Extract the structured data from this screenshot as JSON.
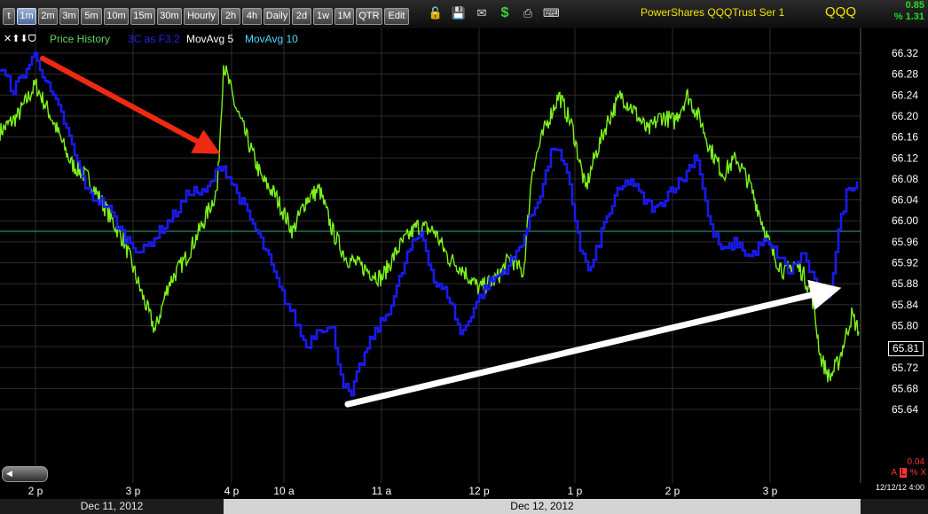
{
  "toolbar": {
    "timeframes": [
      "t",
      "1m",
      "2m",
      "3m",
      "5m",
      "10m",
      "15m",
      "30m",
      "Hourly",
      "2h",
      "4h",
      "Daily",
      "2d",
      "1w",
      "1M",
      "QTR",
      "Edit"
    ],
    "active_timeframe": "1m",
    "icons": [
      "unlock-icon",
      "save-icon",
      "mail-icon",
      "dollar-icon",
      "print-icon",
      "keyboard-icon"
    ],
    "symbol_description": "PowerShares QQQTrust Ser 1",
    "symbol": "QQQ",
    "change": "0.85",
    "change_percent": "% 1.31"
  },
  "legend": {
    "nav_icons": "✕⬆⬇ᗜ",
    "items": [
      {
        "label": "Price History",
        "color": "#5cd65c"
      },
      {
        "label": "3C as F3.2",
        "color": "#2424e0"
      },
      {
        "label": "MovAvg 5",
        "color": "#ffffff"
      },
      {
        "label": "MovAvg 10",
        "color": "#4fd9ff"
      }
    ]
  },
  "footer": {
    "date_left": "Dec 11, 2012",
    "date_right": "Dec 12, 2012",
    "date_stamp": "12/12/12 4:00",
    "volume_label": "0.04",
    "alerts": [
      "A",
      "L",
      "%",
      "X"
    ]
  },
  "colors": {
    "price": "#7cf21c",
    "indicator": "#1a1aee",
    "arrow_down": "#ee2a12",
    "arrow_up": "#ffffff",
    "grid": "#2c2c2c",
    "ref_line": "#2fa98c"
  },
  "chart_data": {
    "type": "line",
    "y_axis": {
      "ticks": [
        66.32,
        66.28,
        66.24,
        66.2,
        66.16,
        66.12,
        66.08,
        66.04,
        66.0,
        65.96,
        65.92,
        65.88,
        65.84,
        65.8,
        65.76,
        65.72,
        65.68,
        65.64
      ],
      "tick_labels": [
        "66.32",
        "66.28",
        "66.24",
        "66.20",
        "66.16",
        "66.12",
        "66.08",
        "66.04",
        "66.00",
        "65.96",
        "65.92",
        "65.88",
        "65.84",
        "65.80",
        "65.76",
        "65.72",
        "65.68",
        "65.64"
      ],
      "range": [
        65.63,
        66.34
      ],
      "current_price": "65.81"
    },
    "x_axis": {
      "tick_labels": [
        "2 p",
        "3 p",
        "4 p",
        "10 a",
        "11 a",
        "12 p",
        "1 p",
        "2 p",
        "3 p"
      ]
    },
    "reference_line": 65.98,
    "series": [
      {
        "name": "Price History",
        "keypoints": [
          [
            0,
            66.17
          ],
          [
            20,
            66.2
          ],
          [
            40,
            66.26
          ],
          [
            60,
            66.19
          ],
          [
            80,
            66.11
          ],
          [
            100,
            66.08
          ],
          [
            120,
            66.02
          ],
          [
            140,
            65.96
          ],
          [
            160,
            65.86
          ],
          [
            175,
            65.79
          ],
          [
            190,
            65.88
          ],
          [
            210,
            65.93
          ],
          [
            230,
            66.0
          ],
          [
            245,
            66.06
          ],
          [
            252,
            66.3
          ],
          [
            265,
            66.22
          ],
          [
            280,
            66.15
          ],
          [
            295,
            66.08
          ],
          [
            310,
            66.05
          ],
          [
            330,
            65.98
          ],
          [
            345,
            66.04
          ],
          [
            360,
            66.06
          ],
          [
            375,
            65.98
          ],
          [
            390,
            65.93
          ],
          [
            410,
            65.91
          ],
          [
            430,
            65.89
          ],
          [
            450,
            65.95
          ],
          [
            470,
            65.99
          ],
          [
            490,
            65.98
          ],
          [
            505,
            65.93
          ],
          [
            520,
            65.91
          ],
          [
            540,
            65.87
          ],
          [
            560,
            65.89
          ],
          [
            575,
            65.93
          ],
          [
            590,
            65.9
          ],
          [
            600,
            66.1
          ],
          [
            615,
            66.18
          ],
          [
            630,
            66.24
          ],
          [
            645,
            66.18
          ],
          [
            660,
            66.06
          ],
          [
            670,
            66.12
          ],
          [
            685,
            66.19
          ],
          [
            700,
            66.24
          ],
          [
            715,
            66.21
          ],
          [
            730,
            66.17
          ],
          [
            745,
            66.2
          ],
          [
            760,
            66.19
          ],
          [
            775,
            66.24
          ],
          [
            790,
            66.19
          ],
          [
            800,
            66.14
          ],
          [
            815,
            66.09
          ],
          [
            830,
            66.12
          ],
          [
            845,
            66.07
          ],
          [
            855,
            66.02
          ],
          [
            870,
            65.94
          ],
          [
            885,
            65.9
          ],
          [
            895,
            65.92
          ],
          [
            905,
            65.9
          ],
          [
            915,
            65.86
          ],
          [
            925,
            65.74
          ],
          [
            935,
            65.7
          ],
          [
            945,
            65.73
          ],
          [
            960,
            65.82
          ],
          [
            968,
            65.79
          ]
        ]
      },
      {
        "name": "3C as F3.2",
        "keypoints": [
          [
            0,
            66.29
          ],
          [
            15,
            66.25
          ],
          [
            30,
            66.29
          ],
          [
            40,
            66.32
          ],
          [
            55,
            66.25
          ],
          [
            70,
            66.2
          ],
          [
            85,
            66.12
          ],
          [
            100,
            66.05
          ],
          [
            120,
            66.03
          ],
          [
            140,
            65.97
          ],
          [
            160,
            65.94
          ],
          [
            180,
            65.98
          ],
          [
            200,
            66.02
          ],
          [
            215,
            66.06
          ],
          [
            230,
            66.05
          ],
          [
            240,
            66.08
          ],
          [
            250,
            66.11
          ],
          [
            265,
            66.06
          ],
          [
            280,
            66.01
          ],
          [
            300,
            65.94
          ],
          [
            315,
            65.87
          ],
          [
            330,
            65.82
          ],
          [
            345,
            65.76
          ],
          [
            360,
            65.8
          ],
          [
            375,
            65.79
          ],
          [
            385,
            65.7
          ],
          [
            395,
            65.66
          ],
          [
            405,
            65.72
          ],
          [
            420,
            65.78
          ],
          [
            435,
            65.82
          ],
          [
            445,
            65.86
          ],
          [
            460,
            65.94
          ],
          [
            475,
            65.98
          ],
          [
            490,
            65.88
          ],
          [
            505,
            65.86
          ],
          [
            520,
            65.78
          ],
          [
            535,
            65.84
          ],
          [
            550,
            65.88
          ],
          [
            565,
            65.9
          ],
          [
            580,
            65.93
          ],
          [
            595,
            65.99
          ],
          [
            610,
            66.06
          ],
          [
            625,
            66.15
          ],
          [
            640,
            66.08
          ],
          [
            655,
            65.94
          ],
          [
            665,
            65.9
          ],
          [
            680,
            65.99
          ],
          [
            695,
            66.05
          ],
          [
            710,
            66.08
          ],
          [
            725,
            66.04
          ],
          [
            740,
            66.02
          ],
          [
            755,
            66.06
          ],
          [
            770,
            66.08
          ],
          [
            785,
            66.13
          ],
          [
            800,
            65.99
          ],
          [
            815,
            65.94
          ],
          [
            830,
            65.96
          ],
          [
            845,
            65.93
          ],
          [
            860,
            65.96
          ],
          [
            875,
            65.94
          ],
          [
            890,
            65.9
          ],
          [
            905,
            65.94
          ],
          [
            920,
            65.87
          ],
          [
            935,
            65.86
          ],
          [
            945,
            65.98
          ],
          [
            955,
            66.06
          ],
          [
            968,
            66.08
          ]
        ]
      }
    ],
    "annotations": [
      {
        "type": "arrow",
        "color": "red",
        "from": {
          "x": 48,
          "y": 66.31
        },
        "to": {
          "x": 246,
          "y": 66.13
        }
      },
      {
        "type": "arrow",
        "color": "white",
        "from": {
          "x": 392,
          "y": 65.65
        },
        "to": {
          "x": 943,
          "y": 65.87
        }
      }
    ]
  }
}
